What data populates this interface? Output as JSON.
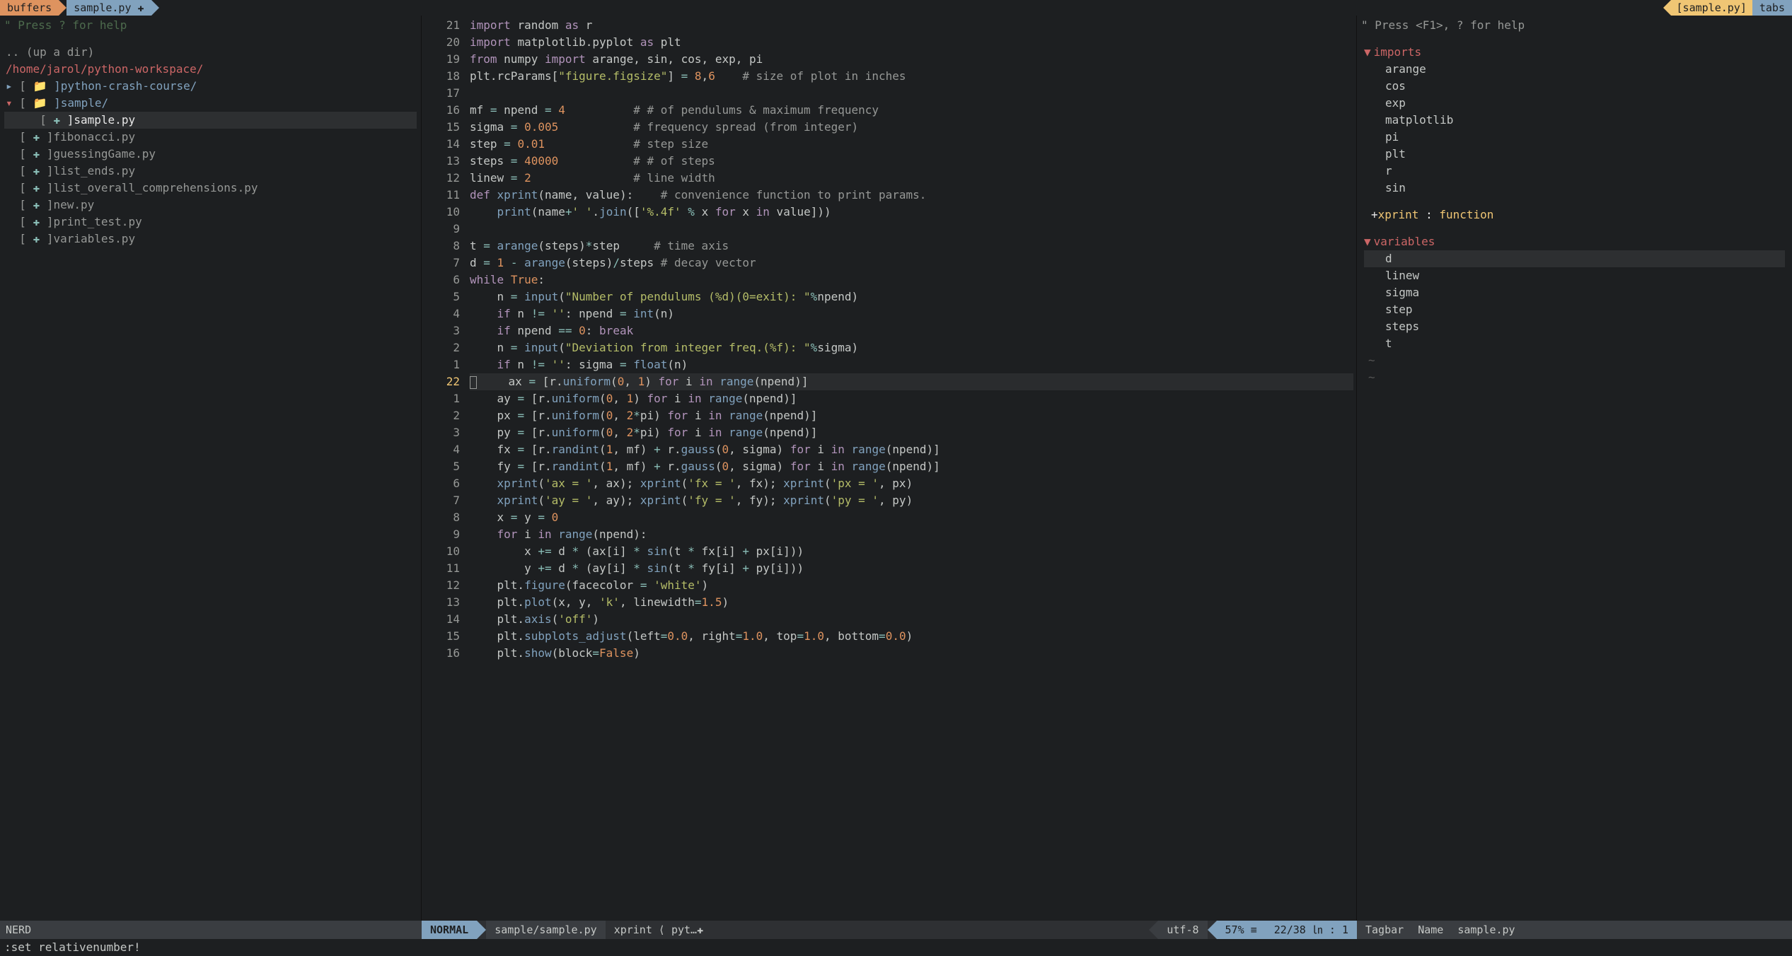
{
  "tabline": {
    "buffers_label": "buffers",
    "current_buffer": "sample.py ✚",
    "right_file": "[sample.py]",
    "tabs_label": "tabs"
  },
  "nerdtree": {
    "help": "\" Press ? for help",
    "up_dir": ".. (up a dir)",
    "root": "/home/jarol/python-workspace/",
    "items": [
      {
        "arrow": "▸",
        "icon": "",
        "name": "]python-crash-course/",
        "dir": true
      },
      {
        "arrow": "▾",
        "icon": "",
        "name": "]sample/",
        "dir": true
      },
      {
        "indent": true,
        "arrow": " ",
        "icon": "✚",
        "name": "]sample.py",
        "sel": true
      },
      {
        "arrow": " ",
        "icon": "✚",
        "name": "]fibonacci.py"
      },
      {
        "arrow": " ",
        "icon": "✚",
        "name": "]guessingGame.py"
      },
      {
        "arrow": " ",
        "icon": "✚",
        "name": "]list_ends.py"
      },
      {
        "arrow": " ",
        "icon": "✚",
        "name": "]list_overall_comprehensions.py"
      },
      {
        "arrow": " ",
        "icon": "✚",
        "name": "]new.py"
      },
      {
        "arrow": " ",
        "icon": "✚",
        "name": "]print_test.py"
      },
      {
        "arrow": " ",
        "icon": "✚",
        "name": "]variables.py"
      }
    ],
    "status": "NERD"
  },
  "editor": {
    "relnums": [
      "21",
      "20",
      "19",
      "18",
      "17",
      "16",
      "15",
      "14",
      "13",
      "12",
      "11",
      "10",
      "9",
      "8",
      "7",
      "6",
      "5",
      "4",
      "3",
      "2",
      "1",
      "22",
      "1",
      "2",
      "3",
      "4",
      "5",
      "6",
      "7",
      "8",
      "9",
      "10",
      "11",
      "12",
      "13",
      "14",
      "15",
      "16"
    ],
    "cursor_index": 21,
    "lines_html": [
      "<span class='kw'>import</span> <span class='id'>random</span> <span class='kw'>as</span> <span class='id'>r</span>",
      "<span class='kw'>import</span> <span class='id'>matplotlib.pyplot</span> <span class='kw'>as</span> <span class='id'>plt</span>",
      "<span class='kw'>from</span> <span class='id'>numpy</span> <span class='kw'>import</span> <span class='id'>arange, sin, cos, exp, pi</span>",
      "<span class='id'>plt.rcParams[</span><span class='str'>\"figure.figsize\"</span><span class='id'>] </span><span class='op'>=</span> <span class='num'>8</span>,<span class='num'>6</span>    <span class='comment'># size of plot in inches</span>",
      "",
      "<span class='id'>mf </span><span class='op'>=</span><span class='id'> npend </span><span class='op'>=</span> <span class='num'>4</span>          <span class='comment'># # of pendulums &amp; maximum frequency</span>",
      "<span class='id'>sigma </span><span class='op'>=</span> <span class='num'>0.005</span>           <span class='comment'># frequency spread (from integer)</span>",
      "<span class='id'>step </span><span class='op'>=</span> <span class='num'>0.01</span>             <span class='comment'># step size</span>",
      "<span class='id'>steps </span><span class='op'>=</span> <span class='num'>40000</span>           <span class='comment'># # of steps</span>",
      "<span class='id'>linew </span><span class='op'>=</span> <span class='num'>2</span>               <span class='comment'># line width</span>",
      "<span class='kw'>def</span> <span class='fn'>xprint</span>(name, value):    <span class='comment'># convenience function to print params.</span>",
      "    <span class='fn'>print</span>(name<span class='op'>+</span><span class='str'>' '</span>.<span class='fn'>join</span>([<span class='str'>'%.4f'</span> <span class='op'>%</span> x <span class='kw'>for</span> x <span class='kw'>in</span> value]))",
      "",
      "<span class='id'>t </span><span class='op'>=</span> <span class='fn'>arange</span>(steps)<span class='op'>*</span>step     <span class='comment'># time axis</span>",
      "<span class='id'>d </span><span class='op'>=</span> <span class='num'>1</span> <span class='op'>-</span> <span class='fn'>arange</span>(steps)<span class='op'>/</span>steps <span class='comment'># decay vector</span>",
      "<span class='kw'>while</span> <span class='num'>True</span>:",
      "    n <span class='op'>=</span> <span class='fn'>input</span>(<span class='str'>\"Number of pendulums (%d)(0=exit): \"</span><span class='op'>%</span>npend)",
      "    <span class='kw'>if</span> n <span class='op'>!=</span> <span class='str'>''</span>: npend <span class='op'>=</span> <span class='fn'>int</span>(n)",
      "    <span class='kw'>if</span> npend <span class='op'>==</span> <span class='num'>0</span>: <span class='kw'>break</span>",
      "    n <span class='op'>=</span> <span class='fn'>input</span>(<span class='str'>\"Deviation from integer freq.(%f): \"</span><span class='op'>%</span>sigma)",
      "    <span class='kw'>if</span> n <span class='op'>!=</span> <span class='str'>''</span>: sigma <span class='op'>=</span> <span class='fn'>float</span>(n)",
      "    ax <span class='op'>=</span> [r.<span class='fn'>uniform</span>(<span class='num'>0</span>, <span class='num'>1</span>) <span class='kw'>for</span> i <span class='kw'>in</span> <span class='fn'>range</span>(npend)]",
      "    ay <span class='op'>=</span> [r.<span class='fn'>uniform</span>(<span class='num'>0</span>, <span class='num'>1</span>) <span class='kw'>for</span> i <span class='kw'>in</span> <span class='fn'>range</span>(npend)]",
      "    px <span class='op'>=</span> [r.<span class='fn'>uniform</span>(<span class='num'>0</span>, <span class='num'>2</span><span class='op'>*</span>pi) <span class='kw'>for</span> i <span class='kw'>in</span> <span class='fn'>range</span>(npend)]",
      "    py <span class='op'>=</span> [r.<span class='fn'>uniform</span>(<span class='num'>0</span>, <span class='num'>2</span><span class='op'>*</span>pi) <span class='kw'>for</span> i <span class='kw'>in</span> <span class='fn'>range</span>(npend)]",
      "    fx <span class='op'>=</span> [r.<span class='fn'>randint</span>(<span class='num'>1</span>, mf) <span class='op'>+</span> r.<span class='fn'>gauss</span>(<span class='num'>0</span>, sigma) <span class='kw'>for</span> i <span class='kw'>in</span> <span class='fn'>range</span>(npend)]",
      "    fy <span class='op'>=</span> [r.<span class='fn'>randint</span>(<span class='num'>1</span>, mf) <span class='op'>+</span> r.<span class='fn'>gauss</span>(<span class='num'>0</span>, sigma) <span class='kw'>for</span> i <span class='kw'>in</span> <span class='fn'>range</span>(npend)]",
      "    <span class='fn'>xprint</span>(<span class='str'>'ax = '</span>, ax); <span class='fn'>xprint</span>(<span class='str'>'fx = '</span>, fx); <span class='fn'>xprint</span>(<span class='str'>'px = '</span>, px)",
      "    <span class='fn'>xprint</span>(<span class='str'>'ay = '</span>, ay); <span class='fn'>xprint</span>(<span class='str'>'fy = '</span>, fy); <span class='fn'>xprint</span>(<span class='str'>'py = '</span>, py)",
      "    x <span class='op'>=</span> y <span class='op'>=</span> <span class='num'>0</span>",
      "    <span class='kw'>for</span> i <span class='kw'>in</span> <span class='fn'>range</span>(npend):",
      "        x <span class='op'>+=</span> d <span class='op'>*</span> (ax[i] <span class='op'>*</span> <span class='fn'>sin</span>(t <span class='op'>*</span> fx[i] <span class='op'>+</span> px[i]))",
      "        y <span class='op'>+=</span> d <span class='op'>*</span> (ay[i] <span class='op'>*</span> <span class='fn'>sin</span>(t <span class='op'>*</span> fy[i] <span class='op'>+</span> py[i]))",
      "    plt.<span class='fn'>figure</span>(facecolor <span class='op'>=</span> <span class='str'>'white'</span>)",
      "    plt.<span class='fn'>plot</span>(x, y, <span class='str'>'k'</span>, linewidth<span class='op'>=</span><span class='num'>1.5</span>)",
      "    plt.<span class='fn'>axis</span>(<span class='str'>'off'</span>)",
      "    plt.<span class='fn'>subplots_adjust</span>(left<span class='op'>=</span><span class='num'>0.0</span>, right<span class='op'>=</span><span class='num'>1.0</span>, top<span class='op'>=</span><span class='num'>1.0</span>, bottom<span class='op'>=</span><span class='num'>0.0</span>)",
      "    plt.<span class='fn'>show</span>(block<span class='op'>=</span><span class='num'>False</span>)"
    ]
  },
  "tagbar": {
    "help": "\" Press <F1>, ? for help",
    "sections": [
      {
        "title": "imports",
        "items": [
          "arange",
          "cos",
          "exp",
          "matplotlib",
          "pi",
          "plt",
          "r",
          "sin"
        ]
      }
    ],
    "function_line": "+xprint : function",
    "vars_title": "variables",
    "vars": [
      "d",
      "linew",
      "sigma",
      "step",
      "steps",
      "t"
    ],
    "selected_var": "d",
    "status_left": "Tagbar",
    "status_mid": "Name",
    "status_file": "sample.py"
  },
  "statusline": {
    "mode": "NORMAL",
    "path": "sample/sample.py",
    "tag": "xprint ⟨ pyt…✚",
    "encoding": "utf-8 ",
    "percent": "57% ≡",
    "position": "22/38 ㏑ : 1 "
  },
  "cmdline": ":set relativenumber!"
}
